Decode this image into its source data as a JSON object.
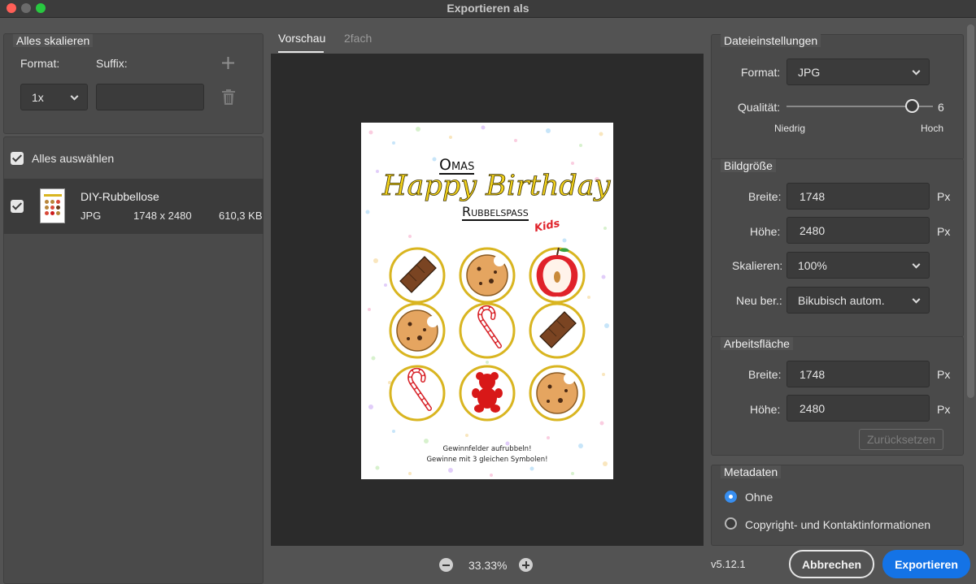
{
  "window": {
    "title": "Exportieren als"
  },
  "left": {
    "scale_all": {
      "title": "Alles skalieren",
      "format_label": "Format:",
      "suffix_label": "Suffix:",
      "scale_value": "1x",
      "suffix_value": ""
    },
    "select_all_label": "Alles auswählen",
    "files": [
      {
        "name": "DIY-Rubbellose",
        "type": "JPG",
        "dimensions": "1748 x 2480",
        "size": "610,3 KB"
      }
    ]
  },
  "preview": {
    "tabs": [
      "Vorschau",
      "2fach"
    ],
    "zoom": "33.33%",
    "poster": {
      "line1": "Omas",
      "line2": "Happy Birthday",
      "line3": "Rubbelspaß",
      "badge": "Kids",
      "footer1": "Gewinnfelder aufrubbeln!",
      "footer2": "Gewinne mit 3 gleichen Symbolen!"
    }
  },
  "right": {
    "file_settings": {
      "title": "Dateieinstellungen",
      "format_label": "Format:",
      "format_value": "JPG",
      "quality_label": "Qualität:",
      "quality_value": "6",
      "quality_fraction": 0.857,
      "low_label": "Niedrig",
      "high_label": "Hoch"
    },
    "image_size": {
      "title": "Bildgröße",
      "width_label": "Breite:",
      "width_value": "1748",
      "height_label": "Höhe:",
      "height_value": "2480",
      "unit": "Px",
      "scale_label": "Skalieren:",
      "scale_value": "100%",
      "resample_label": "Neu ber.:",
      "resample_value": "Bikubisch autom."
    },
    "canvas": {
      "title": "Arbeitsfläche",
      "width_label": "Breite:",
      "width_value": "1748",
      "height_label": "Höhe:",
      "height_value": "2480",
      "unit": "Px",
      "reset_label": "Zurücksetzen"
    },
    "metadata": {
      "title": "Metadaten",
      "options": [
        "Ohne",
        "Copyright- und Kontaktinformationen"
      ],
      "selected": "Ohne"
    }
  },
  "footer": {
    "version": "v5.12.1",
    "cancel_label": "Abbrechen",
    "export_label": "Exportieren"
  },
  "colors": {
    "accent": "#1473e6",
    "radio_selected": "#378ef0",
    "panel_bg": "#535353",
    "preview_bg": "#2b2b2b"
  },
  "icons": [
    "plus-icon",
    "trash-icon",
    "chevron-down-icon",
    "checkbox-checked-icon",
    "zoom-out-icon",
    "zoom-in-icon"
  ]
}
